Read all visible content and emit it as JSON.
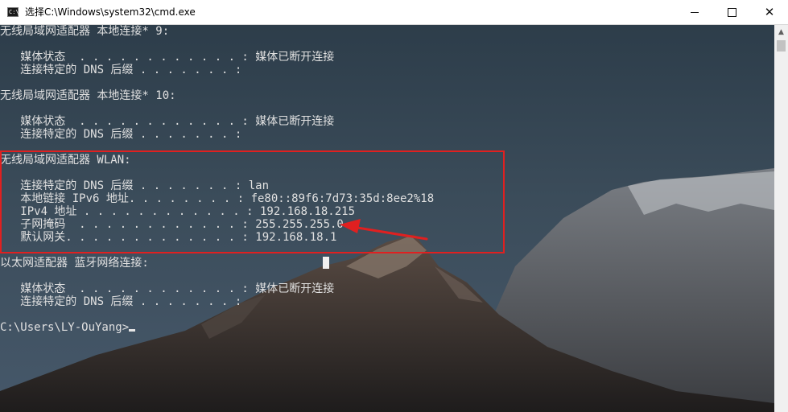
{
  "window": {
    "icon_text": "C:\\",
    "title": "选择C:\\Windows\\system32\\cmd.exe",
    "min_glyph": "minimize",
    "max_glyph": "maximize",
    "close_glyph": "✕"
  },
  "console": {
    "lines": [
      "无线局域网适配器 本地连接* 9:",
      "",
      "   媒体状态  . . . . . . . . . . . . : 媒体已断开连接",
      "   连接特定的 DNS 后缀 . . . . . . . :",
      "",
      "无线局域网适配器 本地连接* 10:",
      "",
      "   媒体状态  . . . . . . . . . . . . : 媒体已断开连接",
      "   连接特定的 DNS 后缀 . . . . . . . :",
      "",
      "无线局域网适配器 WLAN:",
      "",
      "   连接特定的 DNS 后缀 . . . . . . . : lan",
      "   本地链接 IPv6 地址. . . . . . . . : fe80::89f6:7d73:35d:8ee2%18",
      "   IPv4 地址 . . . . . . . . . . . . : 192.168.18.215",
      "   子网掩码  . . . . . . . . . . . . : 255.255.255.0",
      "   默认网关. . . . . . . . . . . . . : 192.168.18.1",
      "",
      "以太网适配器 蓝牙网络连接:",
      "",
      "   媒体状态  . . . . . . . . . . . . : 媒体已断开连接",
      "   连接特定的 DNS 后缀 . . . . . . . :",
      "",
      "C:\\Users\\LY-OuYang>"
    ]
  },
  "annotation": {
    "box_color": "#e02020",
    "arrow_color": "#e02020",
    "highlighted_adapter": "无线局域网适配器 WLAN:",
    "pointed_value": "255.255.255.0"
  },
  "scrollbar": {
    "up_icon": "▲"
  }
}
